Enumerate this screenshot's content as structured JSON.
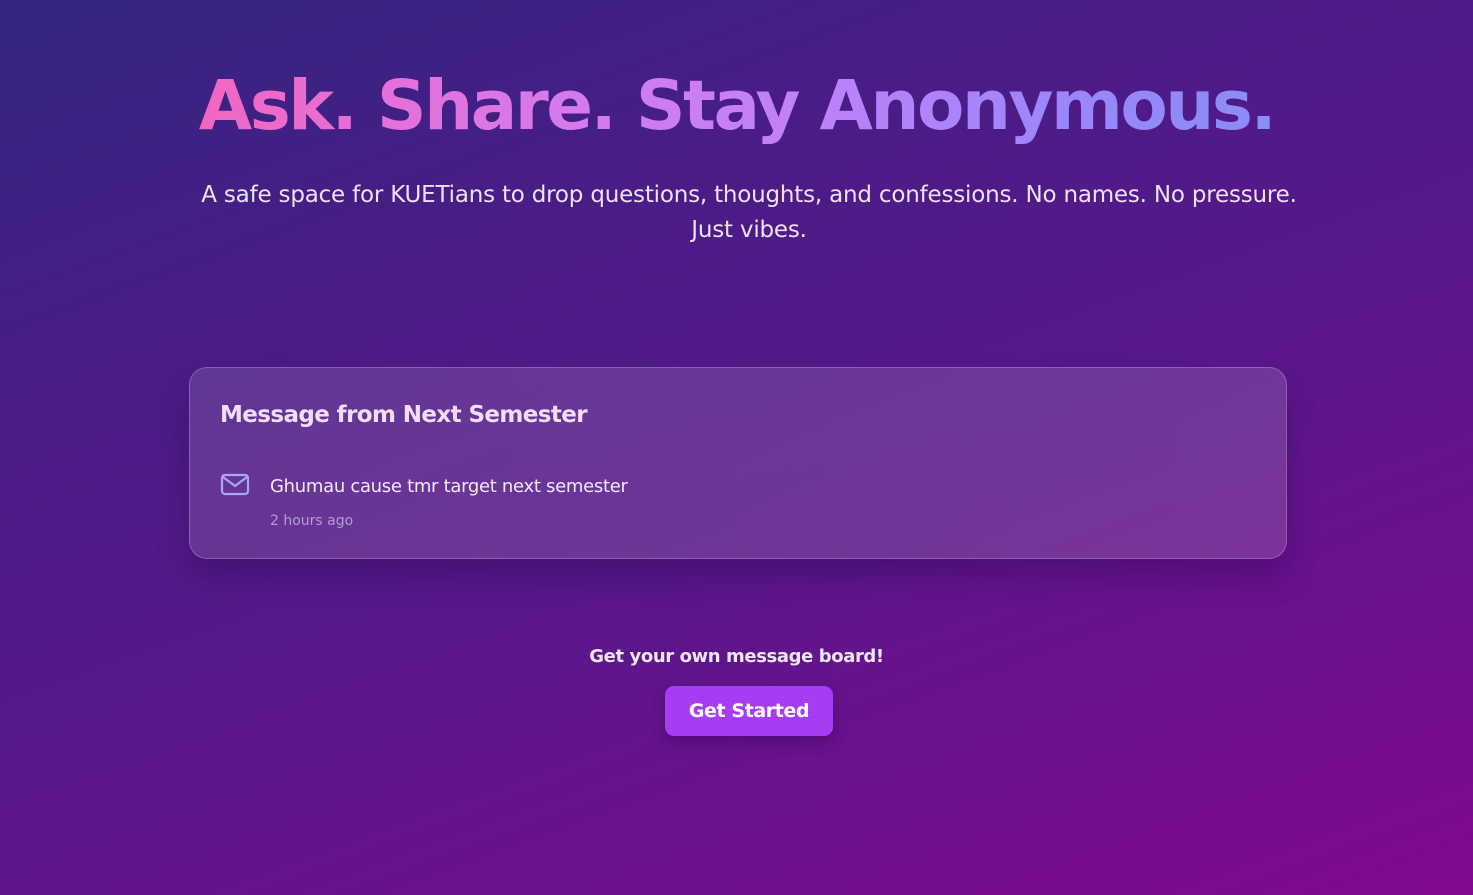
{
  "hero": {
    "title": "Ask. Share. Stay Anonymous.",
    "subtitle": "A safe space for KUETians to drop questions, thoughts, and confessions. No names. No pressure. Just vibes."
  },
  "card": {
    "title": "Message from Next Semester",
    "message": {
      "icon": "mail-icon",
      "text": "Ghumau cause tmr target next semester",
      "time": "2 hours ago"
    }
  },
  "cta": {
    "text": "Get your own message board!",
    "button_label": "Get Started"
  },
  "colors": {
    "accent": "#a73cf5",
    "title_gradient_start": "#f266c2",
    "title_gradient_end": "#8b8cf5",
    "icon": "#a9a6f8"
  }
}
